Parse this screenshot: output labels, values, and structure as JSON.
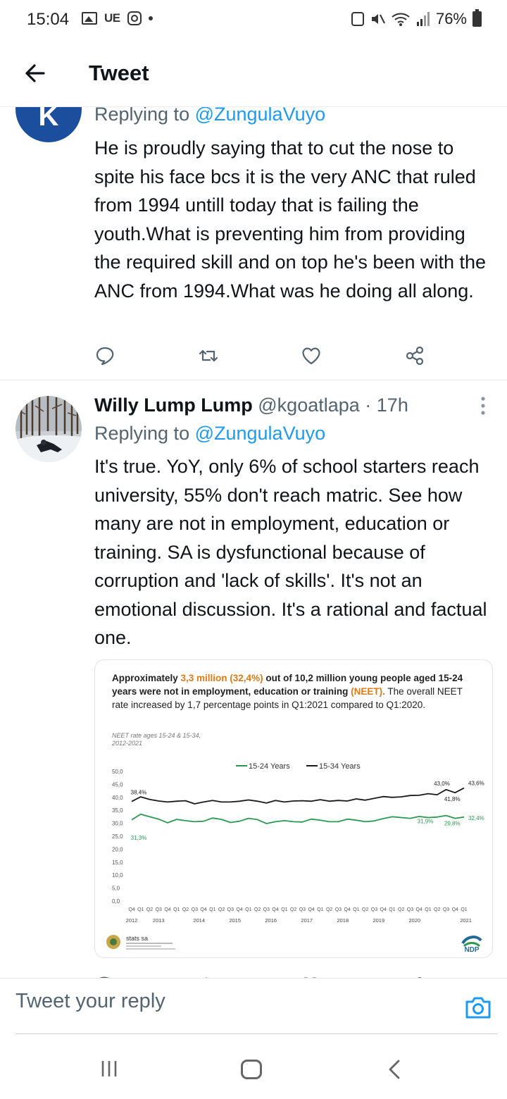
{
  "status_bar": {
    "time": "15:04",
    "carrier_label": "UE",
    "battery": "76%"
  },
  "header": {
    "title": "Tweet"
  },
  "tweet1": {
    "avatar_letter": "K",
    "replying_prefix": "Replying to ",
    "replying_handle": "@ZungulaVuyo",
    "text": "He is proudly saying that to cut the nose to spite his face bcs it is the very ANC that ruled from 1994 untill today that is failing the youth.What is preventing him from providing the required skill and on top he's been with the ANC from 1994.What was he doing all along."
  },
  "tweet2": {
    "name": "Willy Lump Lump",
    "handle": "@kgoatlapa",
    "separator": " · ",
    "time": "17h",
    "replying_prefix": "Replying to ",
    "replying_handle": "@ZungulaVuyo",
    "text": "It's true. YoY, only 6% of school starters reach university, 55% don't reach matric. See how many are not in employment, education or training. SA is dysfunctional because of corruption and 'lack of skills'. It's not an emotional discussion. It's a rational and factual one."
  },
  "chart_card": {
    "headline_a": "Approximately ",
    "headline_b": "3,3 million (32,4%)",
    "headline_c": " out of 10,2 million young people aged 15-24 years were not in employment, education or training ",
    "headline_d": "(NEET).",
    "headline_e": " The overall NEET rate increased by 1,7 percentage points in Q1:2021 compared to Q1:2020.",
    "subtitle_line1": "NEET rate ages 15-24 & 15-34,",
    "subtitle_line2": "2012-2021",
    "stats_logo_text": "stats sa",
    "ndp_text": "NDP"
  },
  "chart_data": {
    "type": "line",
    "ylim": [
      0,
      50
    ],
    "yticks": [
      "50,0",
      "45,0",
      "40,0",
      "35,0",
      "30,0",
      "25,0",
      "20,0",
      "15,0",
      "10,0",
      "5,0",
      "0,0"
    ],
    "quarter_labels": [
      "Q4",
      "Q1",
      "Q2",
      "Q3",
      "Q4",
      "Q1",
      "Q2",
      "Q3",
      "Q4",
      "Q1",
      "Q2",
      "Q3",
      "Q4",
      "Q1",
      "Q2",
      "Q3",
      "Q4",
      "Q1",
      "Q2",
      "Q3",
      "Q4",
      "Q1",
      "Q2",
      "Q3",
      "Q4",
      "Q1",
      "Q2",
      "Q3",
      "Q4",
      "Q1",
      "Q2",
      "Q3",
      "Q4",
      "Q1",
      "Q2",
      "Q3",
      "Q4",
      "Q1"
    ],
    "years": [
      "2012",
      "2013",
      "2014",
      "2015",
      "2016",
      "2017",
      "2018",
      "2019",
      "2020",
      "2021"
    ],
    "legend_position": "top",
    "series": [
      {
        "name": "15-24 Years",
        "color": "#2a9a52",
        "values": [
          31.3,
          33.5,
          32.5,
          31.6,
          30.2,
          31.5,
          31.0,
          30.6,
          30.8,
          32.0,
          31.5,
          30.3,
          30.8,
          31.9,
          31.4,
          29.9,
          30.6,
          31.0,
          30.6,
          30.5,
          31.6,
          31.2,
          30.6,
          30.6,
          31.6,
          31.2,
          30.6,
          30.9,
          31.8,
          32.5,
          32.2,
          31.9,
          32.6,
          32.2,
          32.4,
          33.0,
          31.9,
          32.4
        ],
        "annotations": [
          {
            "index": 0,
            "label": "31,3%"
          },
          {
            "index": 33,
            "label": "31,9%"
          },
          {
            "index": 36,
            "label": "29,8%"
          },
          {
            "index": 37,
            "label": "32,4%"
          }
        ]
      },
      {
        "name": "15-34 Years",
        "color": "#1a1a1a",
        "values": [
          38.4,
          40.2,
          39.2,
          38.6,
          38.2,
          38.5,
          38.7,
          37.5,
          38.2,
          38.8,
          38.2,
          38.2,
          38.5,
          39.0,
          38.5,
          37.8,
          38.8,
          38.2,
          38.6,
          38.7,
          38.5,
          39.1,
          38.5,
          38.8,
          38.6,
          39.4,
          38.9,
          39.6,
          40.3,
          40.0,
          40.2,
          40.7,
          40.8,
          41.4,
          41.0,
          43.0,
          41.8,
          43.6
        ],
        "annotations": [
          {
            "index": 0,
            "label": "38,4%"
          },
          {
            "index": 35,
            "label": "43,0%"
          },
          {
            "index": 36,
            "label": "41,8%"
          },
          {
            "index": 37,
            "label": "43,6%"
          }
        ]
      }
    ]
  },
  "reply_bar": {
    "placeholder": "Tweet your reply"
  }
}
